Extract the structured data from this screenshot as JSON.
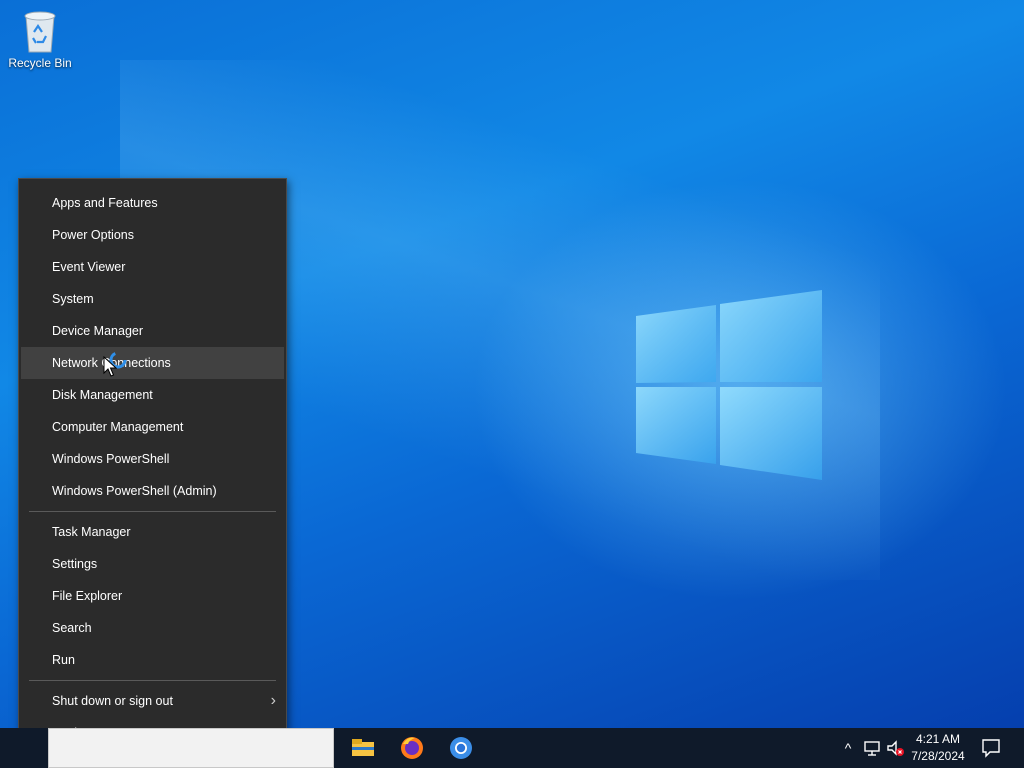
{
  "desktop": {
    "icons": [
      {
        "label": "Recycle Bin",
        "icon": "recycle-bin-icon"
      }
    ],
    "wallpaper": {
      "colors": {
        "primary": "#0a6fd6",
        "glow": "#7fd4ff"
      }
    }
  },
  "context_menu": {
    "groups": [
      [
        {
          "label": "Apps and Features"
        },
        {
          "label": "Power Options"
        },
        {
          "label": "Event Viewer"
        },
        {
          "label": "System"
        },
        {
          "label": "Device Manager"
        },
        {
          "label": "Network Connections",
          "hovered": true
        },
        {
          "label": "Disk Management"
        },
        {
          "label": "Computer Management"
        },
        {
          "label": "Windows PowerShell"
        },
        {
          "label": "Windows PowerShell (Admin)"
        }
      ],
      [
        {
          "label": "Task Manager"
        },
        {
          "label": "Settings"
        },
        {
          "label": "File Explorer"
        },
        {
          "label": "Search"
        },
        {
          "label": "Run"
        }
      ],
      [
        {
          "label": "Shut down or sign out",
          "submenu": true
        },
        {
          "label": "Desktop"
        }
      ]
    ],
    "submenu_arrow": "›"
  },
  "taskbar": {
    "pinned": [
      {
        "name": "file-explorer-icon"
      },
      {
        "name": "firefox-icon"
      },
      {
        "name": "chrome-icon"
      }
    ],
    "tray": {
      "chevron": "^",
      "network_icon": "network-icon",
      "volume_icon": "volume-muted-icon"
    },
    "clock": {
      "time": "4:21 AM",
      "date": "7/28/2024"
    },
    "notification_icon": "action-center-icon"
  }
}
